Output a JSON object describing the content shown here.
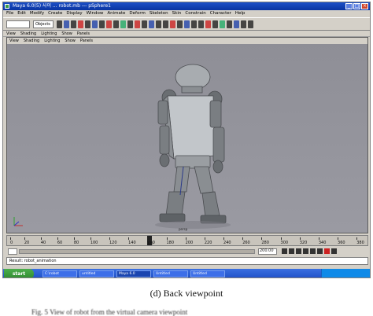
{
  "window": {
    "title": "Maya 6.0(5) 사이 ... robot.mb --- pSphere1"
  },
  "menubar": [
    "File",
    "Edit",
    "Modify",
    "Create",
    "Display",
    "Window",
    "Animate",
    "Deform",
    "Skeleton",
    "Skin",
    "Constrain",
    "Character",
    "Help"
  ],
  "toolbar": {
    "selector_value": "Objects"
  },
  "status_menu": [
    "View",
    "Shading",
    "Lighting",
    "Show",
    "Panels"
  ],
  "viewport": {
    "camera_label": "persp"
  },
  "timeline": {
    "ticks": [
      "0",
      "20",
      "40",
      "60",
      "80",
      "100",
      "120",
      "140",
      "160",
      "180",
      "200",
      "220",
      "240",
      "260",
      "280",
      "300",
      "320",
      "340",
      "360",
      "380"
    ],
    "current_frame": "175",
    "range_end": "200.00"
  },
  "command_line": {
    "text": "Result: robot_animation"
  },
  "taskbar": {
    "start_label": "start",
    "tasks": [
      "C:\\robot",
      "untitled",
      "Maya 6.0",
      "Untitled",
      "Untitled"
    ]
  },
  "caption": {
    "text": "(d) Back viewpoint"
  },
  "footer": {
    "text": "Fig. 5 View of robot from the virtual camera viewpoint"
  },
  "colors": {
    "viewport_bg": "#94949c",
    "robot_body": "#a8acb0"
  }
}
